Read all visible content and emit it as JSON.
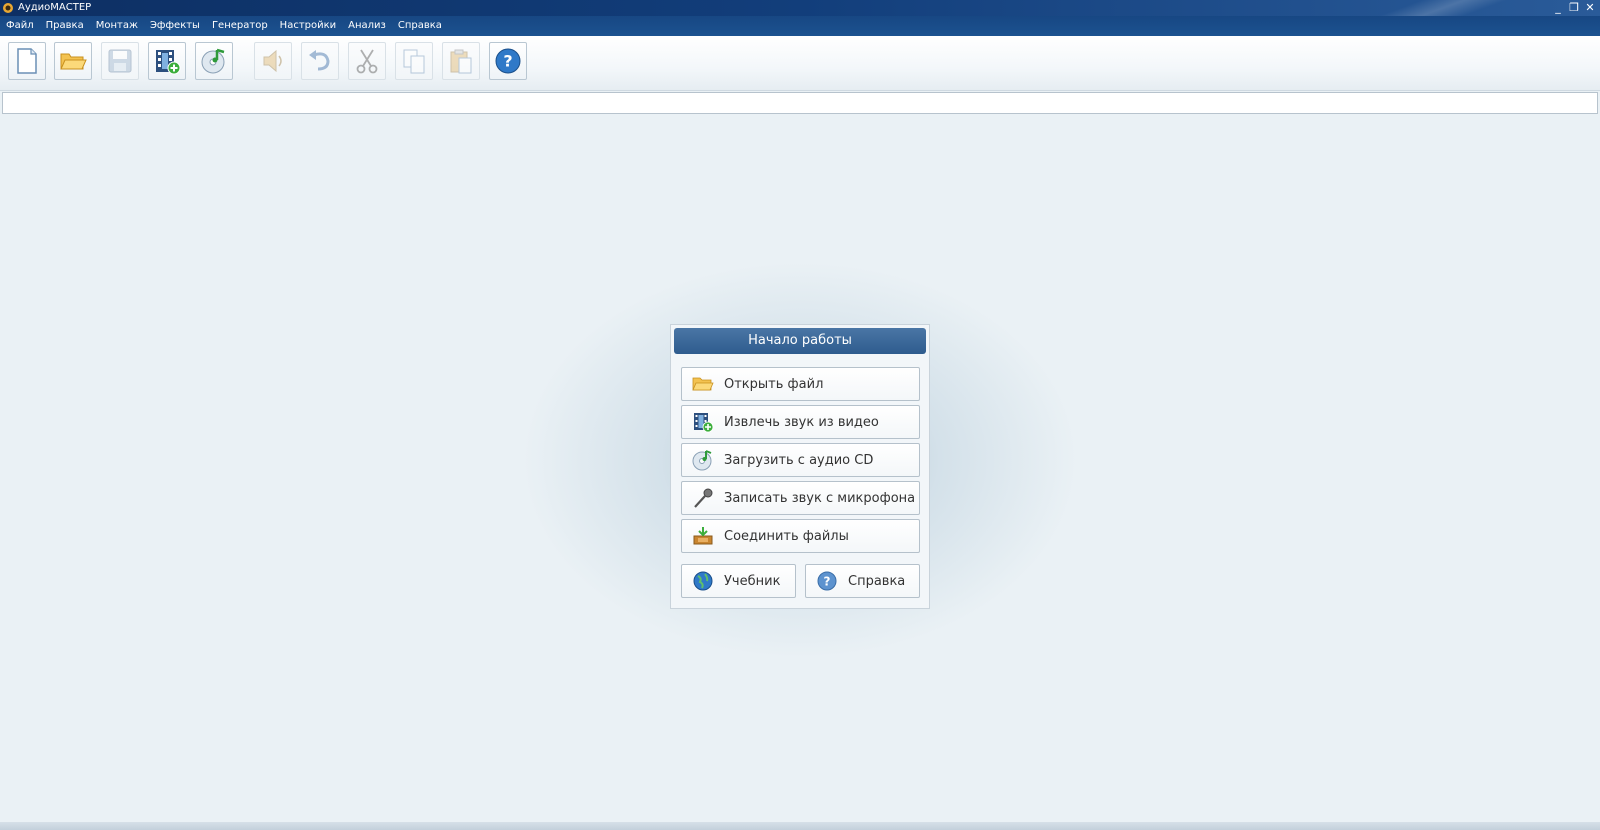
{
  "window": {
    "title": "АудиоМАСТЕР",
    "minimize": "_",
    "restore": "❐",
    "close": "✕"
  },
  "menu": [
    "Файл",
    "Правка",
    "Монтаж",
    "Эффекты",
    "Генератор",
    "Настройки",
    "Анализ",
    "Справка"
  ],
  "toolbar": {
    "buttons": [
      {
        "icon": "new-file-icon",
        "enabled": true
      },
      {
        "icon": "open-folder-icon",
        "enabled": true
      },
      {
        "icon": "save-icon",
        "enabled": false
      },
      {
        "icon": "extract-video-icon",
        "enabled": true
      },
      {
        "icon": "audio-cd-icon",
        "enabled": true
      },
      {
        "icon": "play-sound-icon",
        "enabled": false
      },
      {
        "icon": "undo-icon",
        "enabled": false
      },
      {
        "icon": "cut-icon",
        "enabled": false
      },
      {
        "icon": "copy-icon",
        "enabled": false
      },
      {
        "icon": "paste-icon",
        "enabled": false
      },
      {
        "icon": "help-icon",
        "enabled": true
      }
    ]
  },
  "path_field": {
    "value": ""
  },
  "start_panel": {
    "title": "Начало работы",
    "actions": {
      "open_file": "Открыть файл",
      "extract_audio": "Извлечь звук из видео",
      "load_cd": "Загрузить с аудио CD",
      "record_mic": "Записать звук с микрофона",
      "join_files": "Соединить файлы"
    },
    "tutorial": "Учебник",
    "help": "Справка"
  },
  "colors": {
    "title_bar": "#123e7b",
    "menu_bar": "#1c5290",
    "panel_header": "#2e5c8e",
    "workspace": "#eaf1f5"
  }
}
